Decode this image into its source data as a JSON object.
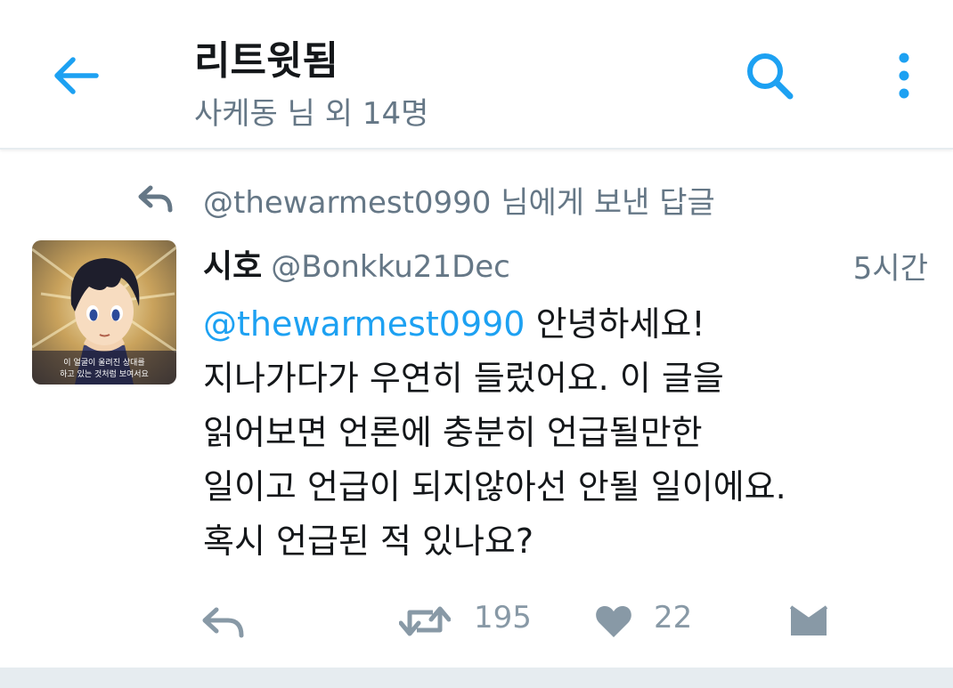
{
  "header": {
    "title": "리트윗됨",
    "subtitle": "사케동 님 외 14명",
    "back_icon": "back-arrow-icon",
    "search_icon": "search-icon",
    "more_icon": "more-vertical-icon"
  },
  "tweet": {
    "reply_context": "@thewarmest0990 님에게 보낸 답글",
    "display_name": "시호",
    "handle": "@Bonkku21Dec",
    "time": "5시간",
    "mention": "@thewarmest0990",
    "text_first_line_rest": " 안녕하세요!",
    "text_lines": [
      "지나가다가 우연히 들렀어요. 이 글을",
      "읽어보면 언론에 충분히 언급될만한",
      "일이고 언급이 되지않아선 안될 일이에요.",
      "혹시 언급된 적 있나요?"
    ],
    "avatar_caption": "이 얼굴이 울려진 상대를 하고 있는 것처럼 보여서요"
  },
  "actions": {
    "reply_icon": "reply-icon",
    "retweet_icon": "retweet-icon",
    "retweet_count": "195",
    "like_icon": "heart-icon",
    "like_count": "22",
    "dm_icon": "envelope-icon"
  },
  "colors": {
    "accent": "#1da1f2",
    "text_primary": "#14171a",
    "text_secondary": "#657786",
    "icon_muted": "#8899a6",
    "divider": "#e6ecf0"
  }
}
